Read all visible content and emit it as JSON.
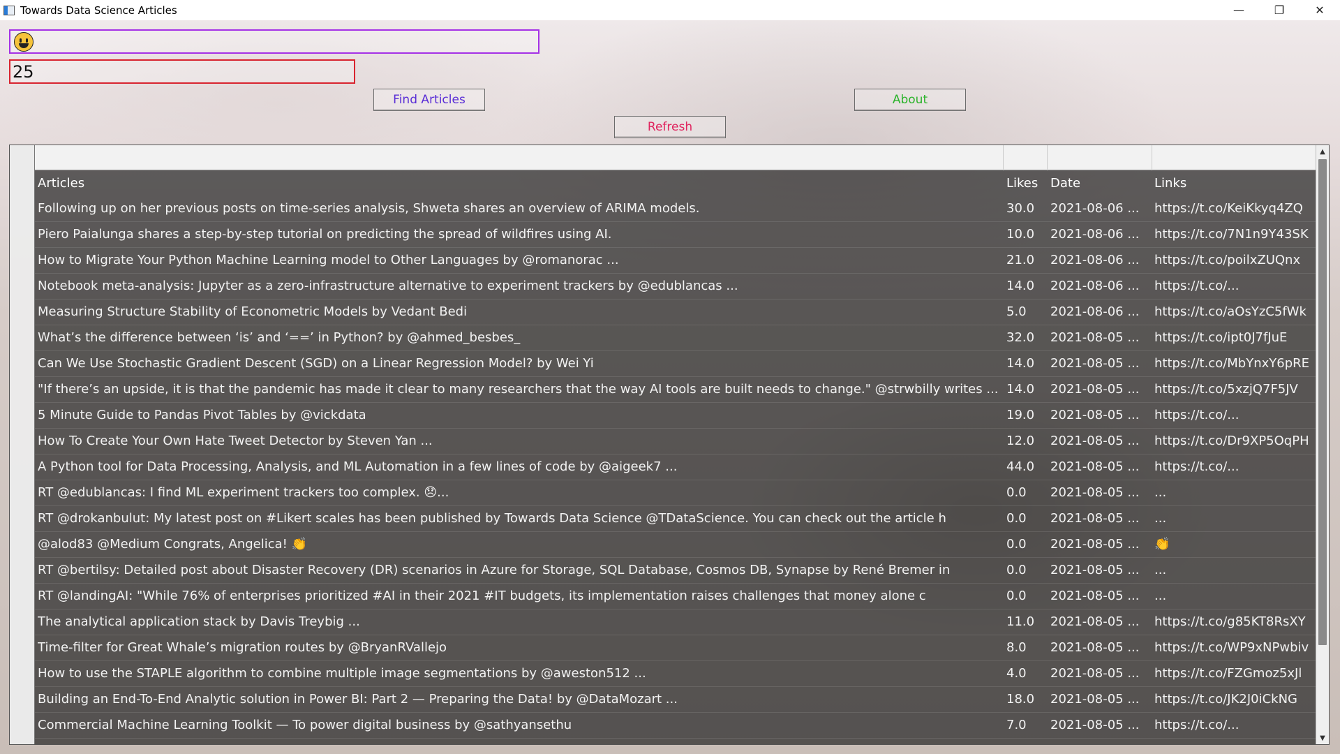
{
  "window": {
    "title": "Towards Data Science Articles",
    "minimize_glyph": "—",
    "restore_glyph": "❐",
    "close_glyph": "✕"
  },
  "inputs": {
    "emoji_value": "😀",
    "count_value": "25"
  },
  "buttons": {
    "find_label": "Find Articles",
    "about_label": "About",
    "refresh_label": "Refresh"
  },
  "colors": {
    "emoji_border": "#a531e6",
    "count_border": "#d8242f",
    "find_text": "#5a2ed6",
    "about_text": "#2bb32b",
    "refresh_text": "#e0245e"
  },
  "table": {
    "headers": {
      "articles": "Articles",
      "likes": "Likes",
      "date": "Date",
      "links": "Links"
    },
    "rows": [
      {
        "article": "Following up on her previous posts on time-series analysis, Shweta shares an overview of ARIMA models.",
        "likes": "30.0",
        "date": "2021-08-06 ...",
        "link": "https://t.co/KeiKkyq4ZQ"
      },
      {
        "article": "Piero Paialunga shares a step-by-step tutorial on predicting the spread of wildfires using AI.",
        "likes": "10.0",
        "date": "2021-08-06 ...",
        "link": "https://t.co/7N1n9Y43SK"
      },
      {
        "article": "How to Migrate Your Python Machine Learning model to Other Languages by @romanorac ...",
        "likes": "21.0",
        "date": "2021-08-06 ...",
        "link": "https://t.co/poilxZUQnx"
      },
      {
        "article": "Notebook meta-analysis: Jupyter as a zero-infrastructure alternative to experiment trackers by @edublancas ...",
        "likes": "14.0",
        "date": "2021-08-06 ...",
        "link": "https://t.co/..."
      },
      {
        "article": "Measuring Structure Stability of Econometric Models by Vedant Bedi",
        "likes": "5.0",
        "date": "2021-08-06 ...",
        "link": "https://t.co/aOsYzC5fWk"
      },
      {
        "article": "What’s the difference between ‘is’ and ‘==’ in Python? by @ahmed_besbes_",
        "likes": "32.0",
        "date": "2021-08-05 ...",
        "link": "https://t.co/ipt0J7fJuE"
      },
      {
        "article": "Can We Use Stochastic Gradient Descent (SGD) on a Linear Regression Model? by Wei Yi",
        "likes": "14.0",
        "date": "2021-08-05 ...",
        "link": "https://t.co/MbYnxY6pRE"
      },
      {
        "article": "\"If there’s an upside, it is that the pandemic has made it clear to many researchers that the way AI tools are built needs to change.\" @strwbilly writes ...",
        "likes": "14.0",
        "date": "2021-08-05 ...",
        "link": "https://t.co/5xzjQ7F5JV"
      },
      {
        "article": "5 Minute Guide to Pandas Pivot Tables by @vickdata",
        "likes": "19.0",
        "date": "2021-08-05 ...",
        "link": "https://t.co/..."
      },
      {
        "article": "How To Create Your Own Hate Tweet Detector by Steven Yan ...",
        "likes": "12.0",
        "date": "2021-08-05 ...",
        "link": "https://t.co/Dr9XP5OqPH"
      },
      {
        "article": "A Python tool for Data Processing, Analysis, and ML Automation in a few lines of code by @aigeek7 ...",
        "likes": "44.0",
        "date": "2021-08-05 ...",
        "link": "https://t.co/..."
      },
      {
        "article": "RT @edublancas: I find ML experiment trackers too complex. 😞...",
        "likes": "0.0",
        "date": "2021-08-05 ...",
        "link": "..."
      },
      {
        "article": "RT @drokanbulut: My latest post on #Likert scales has been published by Towards Data Science @TDataScience. You can check out the article h",
        "likes": "0.0",
        "date": "2021-08-05 ...",
        "link": "..."
      },
      {
        "article": "@alod83 @Medium Congrats, Angelica! 👏",
        "likes": "0.0",
        "date": "2021-08-05 ...",
        "link": "👏"
      },
      {
        "article": "RT @bertilsy: Detailed post about Disaster Recovery (DR) scenarios in Azure for Storage, SQL Database, Cosmos DB, Synapse by René Bremer in",
        "likes": "0.0",
        "date": "2021-08-05 ...",
        "link": "..."
      },
      {
        "article": "RT @landingAI: \"While 76% of enterprises prioritized #AI in their 2021 #IT budgets, its implementation raises challenges that money alone c",
        "likes": "0.0",
        "date": "2021-08-05 ...",
        "link": "..."
      },
      {
        "article": "The analytical application stack by Davis Treybig ...",
        "likes": "11.0",
        "date": "2021-08-05 ...",
        "link": "https://t.co/g85KT8RsXY"
      },
      {
        "article": "Time-filter for Great Whale’s migration routes by @BryanRVallejo",
        "likes": "8.0",
        "date": "2021-08-05 ...",
        "link": "https://t.co/WP9xNPwbiv"
      },
      {
        "article": "How to use the STAPLE algorithm to combine multiple image segmentations by @aweston512 ...",
        "likes": "4.0",
        "date": "2021-08-05 ...",
        "link": "https://t.co/FZGmoz5xJl"
      },
      {
        "article": "Building an End-To-End Analytic solution in Power BI: Part 2 — Preparing the Data! by @DataMozart ...",
        "likes": "18.0",
        "date": "2021-08-05 ...",
        "link": "https://t.co/JK2J0iCkNG"
      },
      {
        "article": "Commercial Machine Learning Toolkit — To power digital business by @sathyansethu",
        "likes": "7.0",
        "date": "2021-08-05 ...",
        "link": "https://t.co/..."
      }
    ]
  }
}
